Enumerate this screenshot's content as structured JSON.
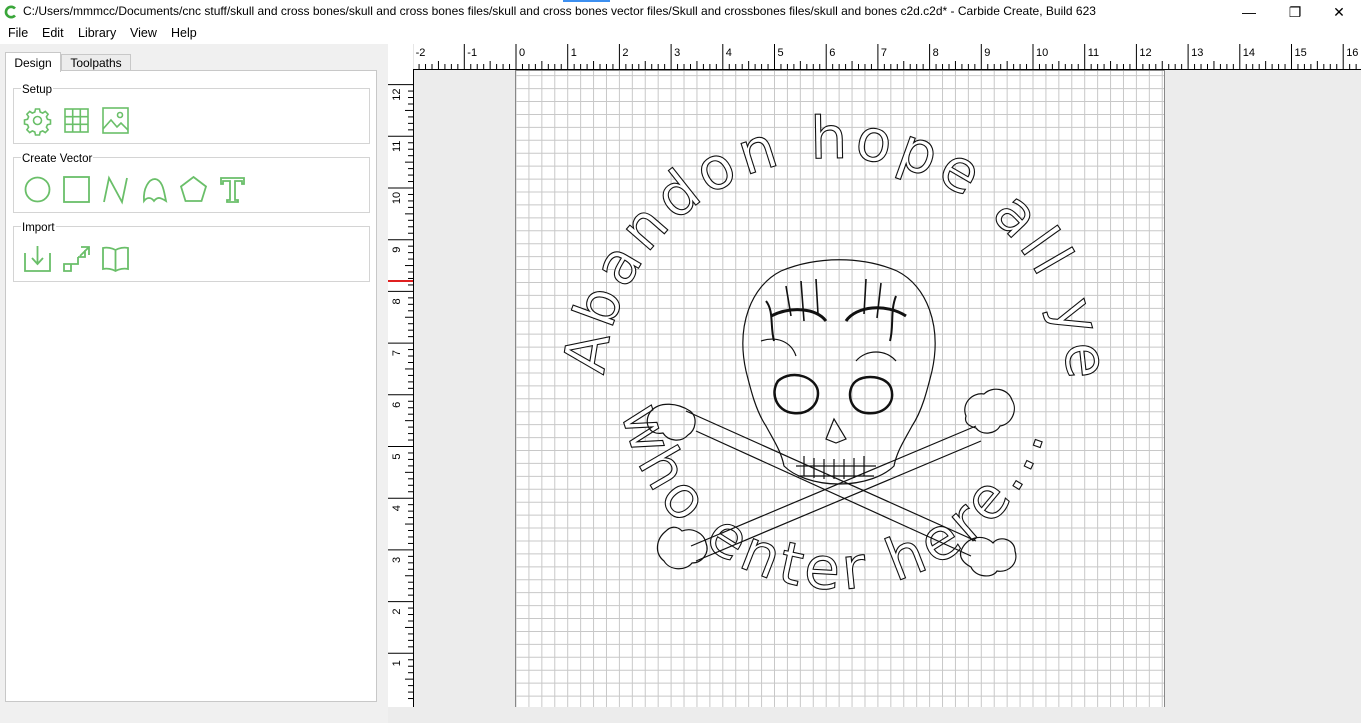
{
  "window": {
    "title": "C:/Users/mmmcc/Documents/cnc stuff/skull and cross bones/skull and cross bones files/skull and cross bones vector files/Skull and crossbones files/skull and bones c2d.c2d* - Carbide Create, Build 623",
    "minimize_glyph": "—",
    "maximize_glyph": "❐",
    "close_glyph": "✕"
  },
  "menu": [
    "File",
    "Edit",
    "Library",
    "View",
    "Help"
  ],
  "tabs": {
    "design": "Design",
    "toolpaths": "Toolpaths"
  },
  "groups": {
    "setup": {
      "title": "Setup",
      "icons": [
        "gear-icon",
        "grid-icon",
        "image-icon"
      ]
    },
    "create_vector": {
      "title": "Create Vector",
      "icons": [
        "circle-icon",
        "rectangle-icon",
        "polyline-icon",
        "curve-icon",
        "polygon-icon",
        "text-icon"
      ]
    },
    "import": {
      "title": "Import",
      "icons": [
        "import-svg-icon",
        "import-image-icon",
        "open-library-icon"
      ]
    }
  },
  "colors": {
    "icon_green": "#6abf69",
    "ruler_marker": "#e02020",
    "grid": "#c8c8c8"
  },
  "rulers": {
    "horizontal": [
      "-2",
      "-1",
      "0",
      "1",
      "2",
      "3",
      "4",
      "5",
      "6",
      "7",
      "8",
      "9",
      "10",
      "11",
      "12",
      "13",
      "14",
      "15",
      "16"
    ],
    "vertical": [
      "12",
      "11",
      "10",
      "9",
      "8",
      "7",
      "6",
      "5",
      "4",
      "3",
      "2",
      "1"
    ]
  },
  "canvas": {
    "text_top": "Abandon hope all ye",
    "text_bottom": "who enter here..."
  }
}
